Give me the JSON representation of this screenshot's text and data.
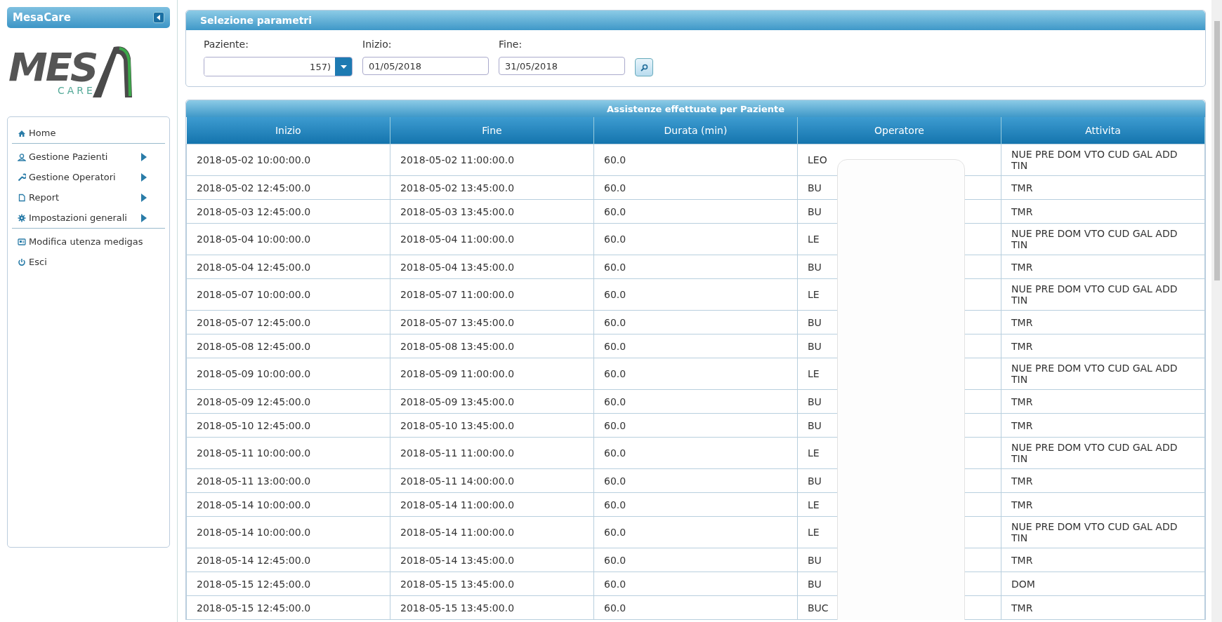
{
  "sidebar": {
    "title": "MesaCare",
    "logo": {
      "text": "MES",
      "subtext": "CARE"
    },
    "menu": [
      {
        "label": "Home",
        "submenu": false,
        "divider_after": true
      },
      {
        "label": "Gestione Pazienti",
        "submenu": true,
        "divider_after": false
      },
      {
        "label": "Gestione Operatori",
        "submenu": true,
        "divider_after": false
      },
      {
        "label": "Report",
        "submenu": true,
        "divider_after": false
      },
      {
        "label": "Impostazioni generali",
        "submenu": true,
        "divider_after": true
      },
      {
        "label": "Modifica utenza medigas",
        "submenu": false,
        "divider_after": false
      },
      {
        "label": "Esci",
        "submenu": false,
        "divider_after": false
      }
    ]
  },
  "parameters": {
    "title": "Selezione parametri",
    "patient": {
      "label": "Paziente:",
      "value": "157)"
    },
    "start": {
      "label": "Inizio:",
      "value": "01/05/2018"
    },
    "end": {
      "label": "Fine:",
      "value": "31/05/2018"
    }
  },
  "table": {
    "title": "Assistenze effettuate per Paziente",
    "columns": [
      "Inizio",
      "Fine",
      "Durata (min)",
      "Operatore",
      "Attivita"
    ],
    "rows": [
      [
        "2018-05-02 10:00:00.0",
        "2018-05-02 11:00:00.0",
        "60.0",
        "LEO",
        "NUE PRE DOM VTO CUD GAL ADD TIN"
      ],
      [
        "2018-05-02 12:45:00.0",
        "2018-05-02 13:45:00.0",
        "60.0",
        "BU",
        "TMR"
      ],
      [
        "2018-05-03 12:45:00.0",
        "2018-05-03 13:45:00.0",
        "60.0",
        "BU",
        "TMR"
      ],
      [
        "2018-05-04 10:00:00.0",
        "2018-05-04 11:00:00.0",
        "60.0",
        "LE",
        "NUE PRE DOM VTO CUD GAL ADD TIN"
      ],
      [
        "2018-05-04 12:45:00.0",
        "2018-05-04 13:45:00.0",
        "60.0",
        "BU",
        "TMR"
      ],
      [
        "2018-05-07 10:00:00.0",
        "2018-05-07 11:00:00.0",
        "60.0",
        "LE",
        "NUE PRE DOM VTO CUD GAL ADD TIN"
      ],
      [
        "2018-05-07 12:45:00.0",
        "2018-05-07 13:45:00.0",
        "60.0",
        "BU",
        "TMR"
      ],
      [
        "2018-05-08 12:45:00.0",
        "2018-05-08 13:45:00.0",
        "60.0",
        "BU",
        "TMR"
      ],
      [
        "2018-05-09 10:00:00.0",
        "2018-05-09 11:00:00.0",
        "60.0",
        "LE",
        "NUE PRE DOM VTO CUD GAL ADD TIN"
      ],
      [
        "2018-05-09 12:45:00.0",
        "2018-05-09 13:45:00.0",
        "60.0",
        "BU",
        "TMR"
      ],
      [
        "2018-05-10 12:45:00.0",
        "2018-05-10 13:45:00.0",
        "60.0",
        "BU",
        "TMR"
      ],
      [
        "2018-05-11 10:00:00.0",
        "2018-05-11 11:00:00.0",
        "60.0",
        "LE",
        "NUE PRE DOM VTO CUD GAL ADD TIN"
      ],
      [
        "2018-05-11 13:00:00.0",
        "2018-05-11 14:00:00.0",
        "60.0",
        "BU",
        "TMR"
      ],
      [
        "2018-05-14 10:00:00.0",
        "2018-05-14 11:00:00.0",
        "60.0",
        "LE",
        "TMR"
      ],
      [
        "2018-05-14 10:00:00.0",
        "2018-05-14 11:00:00.0",
        "60.0",
        "LE",
        "NUE PRE DOM VTO CUD GAL ADD TIN"
      ],
      [
        "2018-05-14 12:45:00.0",
        "2018-05-14 13:45:00.0",
        "60.0",
        "BU",
        "TMR"
      ],
      [
        "2018-05-15 12:45:00.0",
        "2018-05-15 13:45:00.0",
        "60.0",
        "BU",
        "DOM"
      ],
      [
        "2018-05-15 12:45:00.0",
        "2018-05-15 13:45:00.0",
        "60.0",
        "BUC",
        "TMR"
      ]
    ]
  }
}
